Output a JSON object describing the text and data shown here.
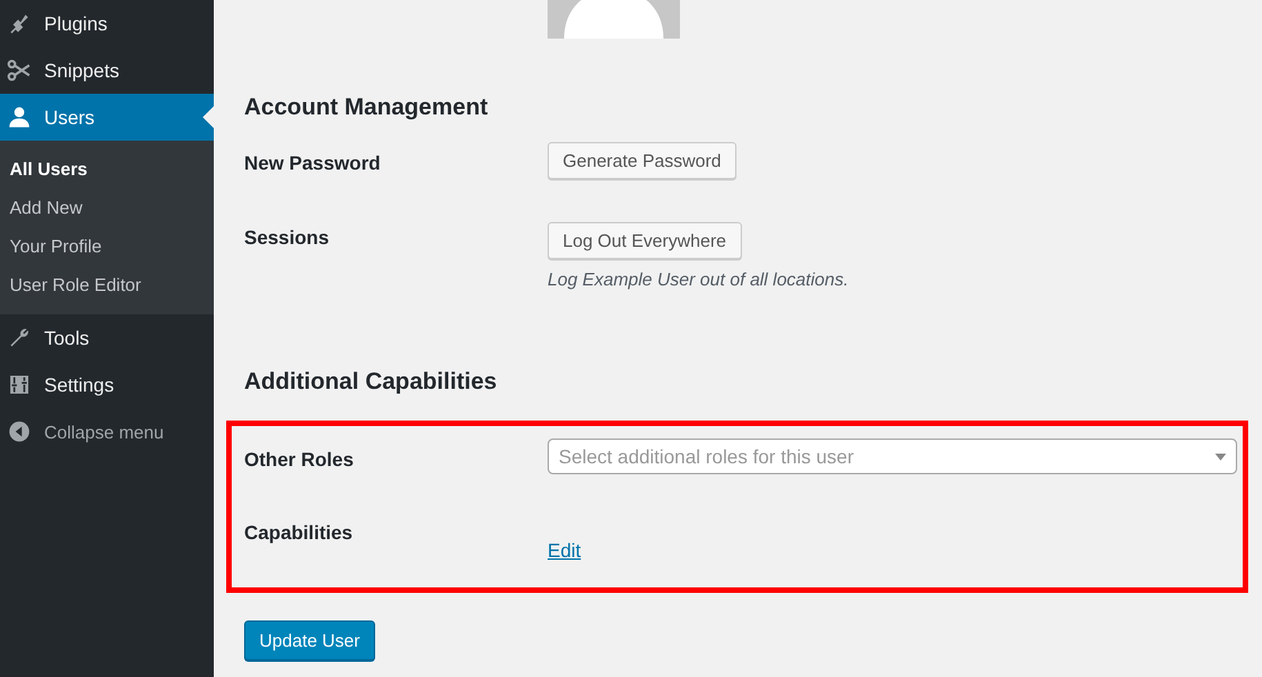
{
  "sidebar": {
    "items": [
      {
        "label": "Plugins",
        "selected": false
      },
      {
        "label": "Snippets",
        "selected": false
      },
      {
        "label": "Users",
        "selected": true,
        "children": [
          {
            "label": "All Users",
            "selected": true
          },
          {
            "label": "Add New",
            "selected": false
          },
          {
            "label": "Your Profile",
            "selected": false
          },
          {
            "label": "User Role Editor",
            "selected": false
          }
        ]
      },
      {
        "label": "Tools",
        "selected": false
      },
      {
        "label": "Settings",
        "selected": false
      }
    ],
    "collapse": "Collapse menu"
  },
  "sections": [
    {
      "heading": "Account Management",
      "rows": [
        {
          "label": "New Password",
          "kind": "button",
          "button": "Generate Password"
        },
        {
          "label": "Sessions",
          "kind": "button",
          "button": "Log Out Everywhere",
          "description": "Log Example User out of all locations."
        }
      ]
    },
    {
      "heading": "Additional Capabilities",
      "highlighted": true,
      "rows": [
        {
          "label": "Other Roles",
          "kind": "select",
          "placeholder": "Select additional roles for this user"
        },
        {
          "label": "Capabilities",
          "kind": "link",
          "link": "Edit"
        }
      ]
    }
  ],
  "submit": "Update User"
}
